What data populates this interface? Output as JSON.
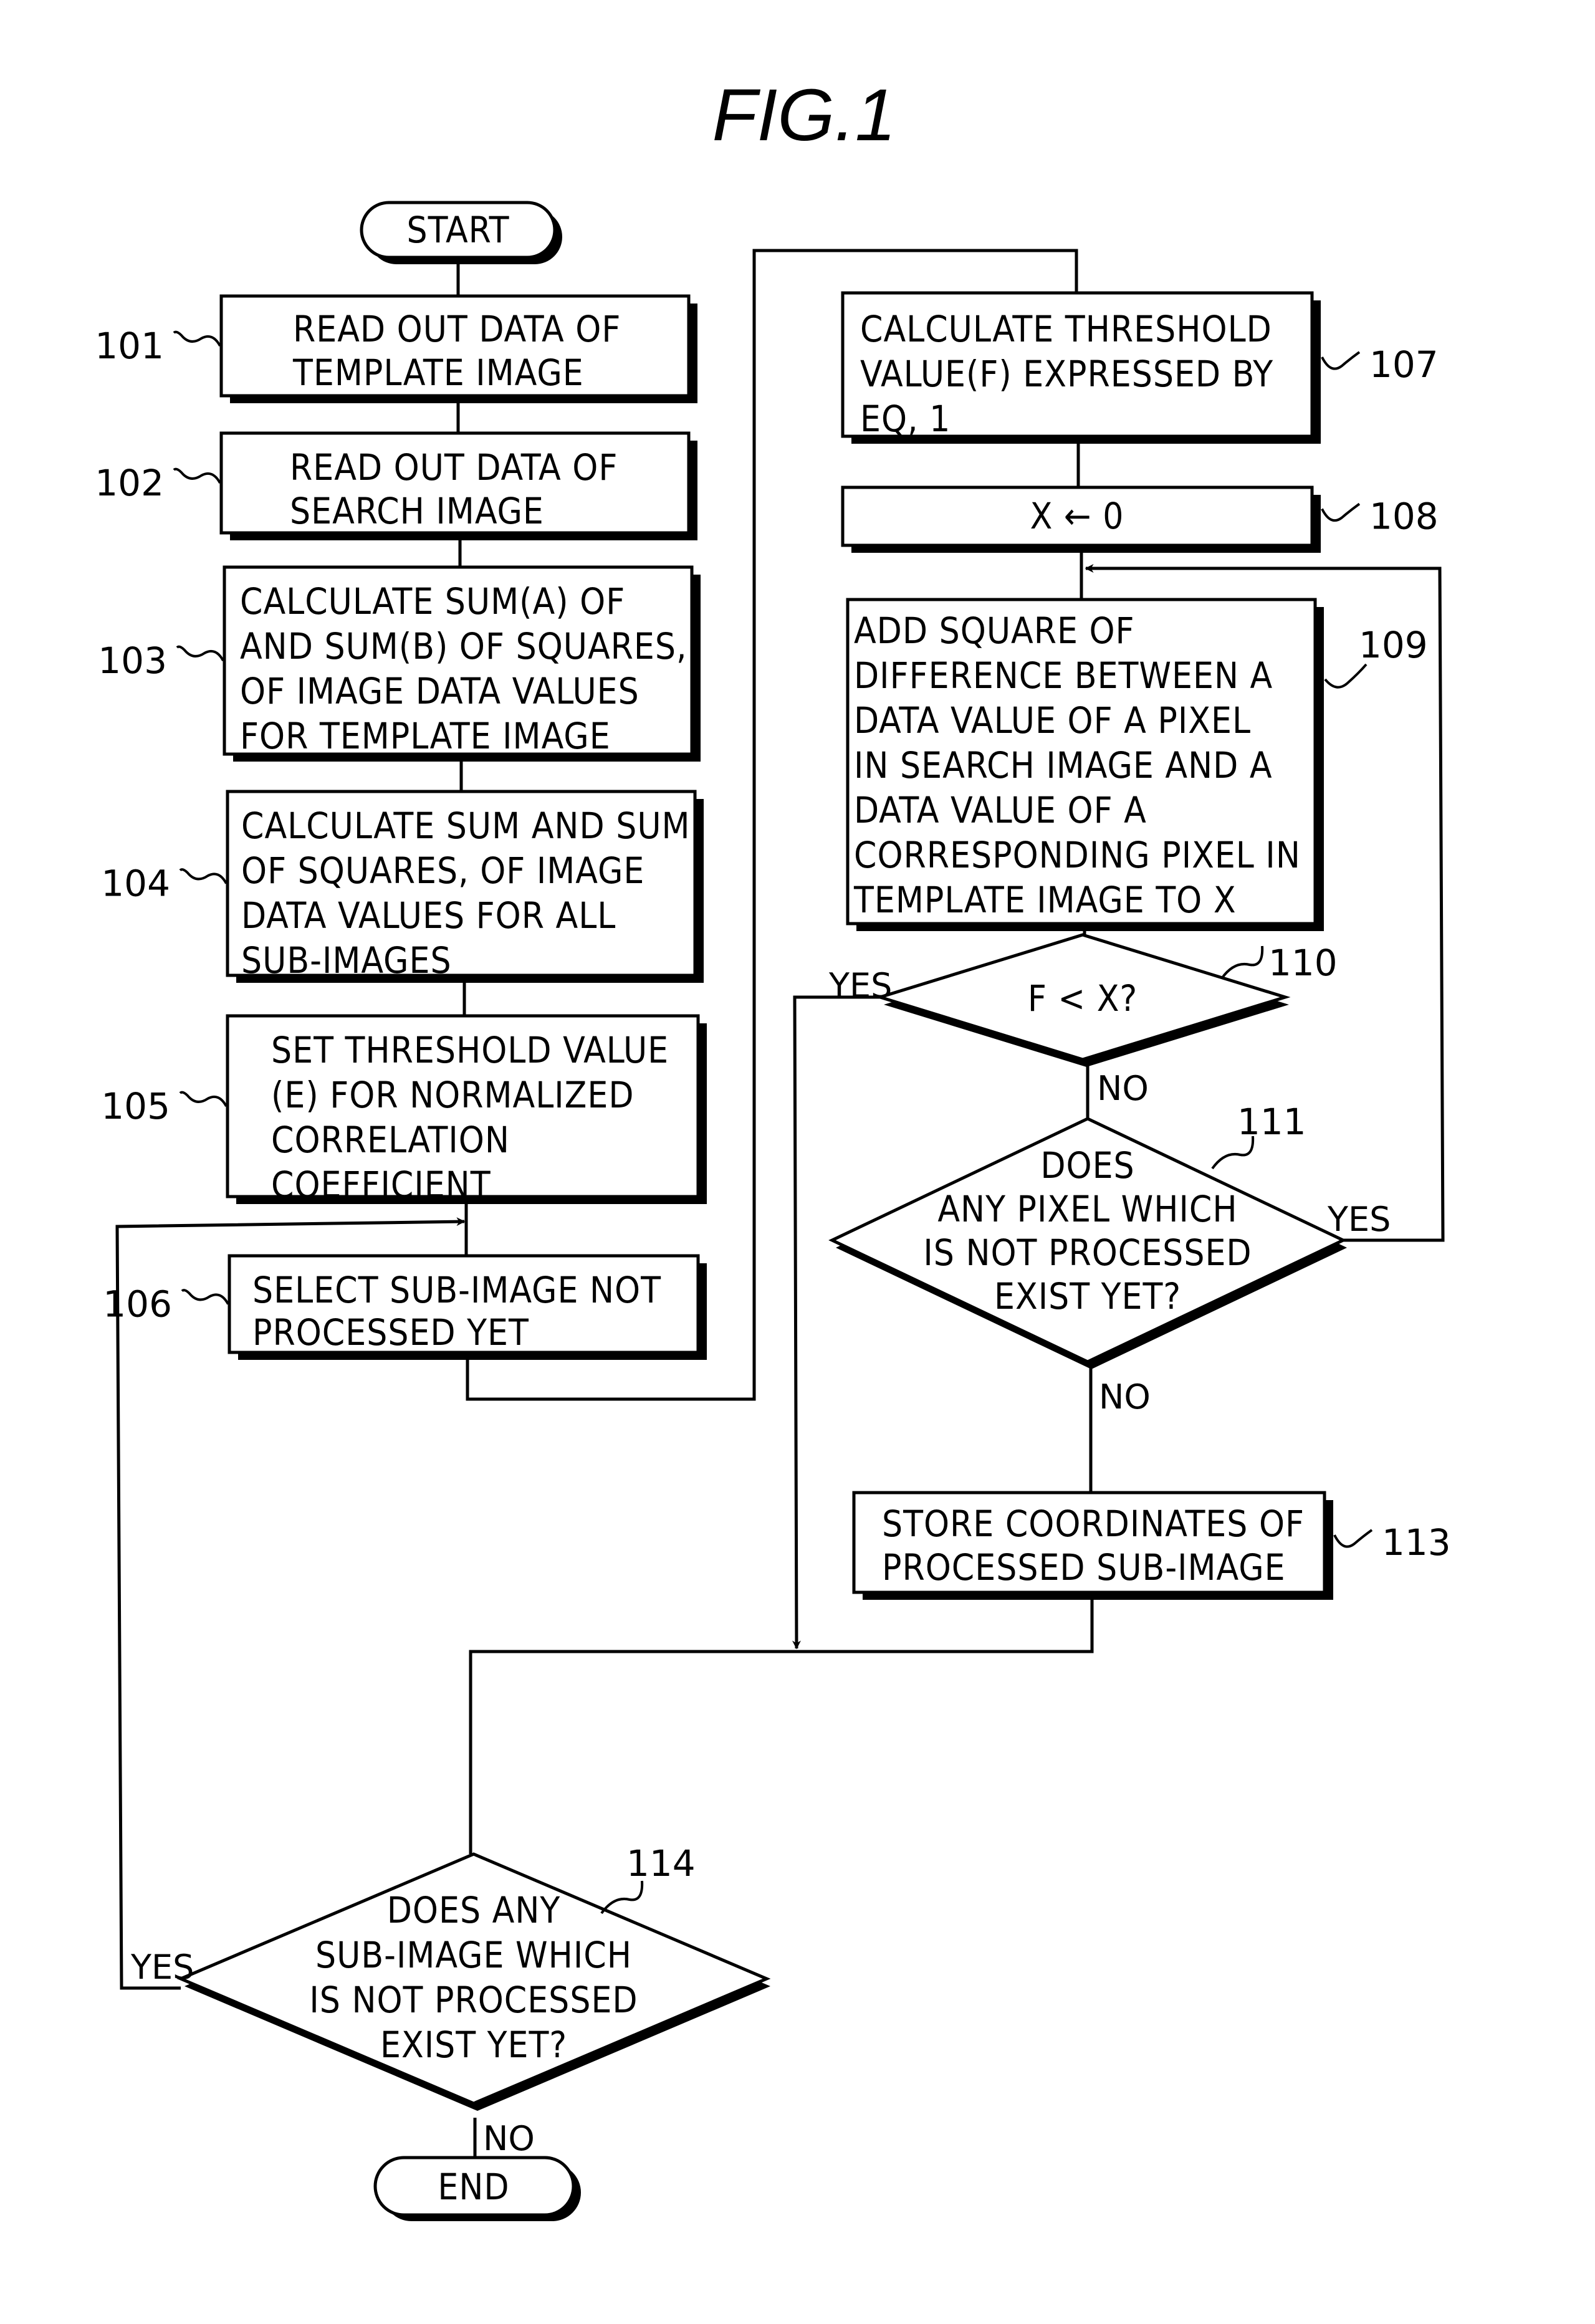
{
  "figure": {
    "title": "FIG.1"
  },
  "terminals": {
    "start": "START",
    "end": "END"
  },
  "steps": [
    {
      "ref": "101",
      "lines": [
        "READ OUT DATA OF",
        "TEMPLATE IMAGE"
      ]
    },
    {
      "ref": "102",
      "lines": [
        "READ OUT DATA OF",
        "SEARCH IMAGE"
      ]
    },
    {
      "ref": "103",
      "lines": [
        "CALCULATE SUM(A) OF",
        "AND SUM(B) OF SQUARES,",
        "OF IMAGE DATA VALUES",
        "FOR TEMPLATE IMAGE"
      ]
    },
    {
      "ref": "104",
      "lines": [
        "CALCULATE SUM AND SUM",
        "OF SQUARES, OF IMAGE",
        "DATA VALUES FOR ALL",
        "SUB-IMAGES"
      ]
    },
    {
      "ref": "105",
      "lines": [
        "SET THRESHOLD VALUE",
        "(E) FOR NORMALIZED",
        "CORRELATION",
        "COEFFICIENT"
      ]
    },
    {
      "ref": "106",
      "lines": [
        "SELECT SUB-IMAGE NOT",
        "PROCESSED YET"
      ]
    },
    {
      "ref": "107",
      "lines": [
        "CALCULATE THRESHOLD",
        "VALUE(F) EXPRESSED BY",
        "EQ, 1"
      ]
    },
    {
      "ref": "108",
      "lines": [
        "X ← 0"
      ]
    },
    {
      "ref": "109",
      "lines": [
        "ADD SQUARE OF",
        "DIFFERENCE BETWEEN A",
        "DATA VALUE OF A PIXEL",
        "IN SEARCH IMAGE AND A",
        "DATA VALUE OF A",
        "CORRESPONDING PIXEL IN",
        "TEMPLATE IMAGE TO X"
      ]
    },
    {
      "ref": "113",
      "lines": [
        "STORE COORDINATES OF",
        "PROCESSED SUB-IMAGE"
      ]
    }
  ],
  "decisions": [
    {
      "ref": "110",
      "lines": [
        "F < X?"
      ],
      "yes": "YES",
      "no": "NO"
    },
    {
      "ref": "111",
      "lines": [
        "DOES",
        "ANY PIXEL WHICH",
        "IS NOT PROCESSED",
        "EXIST YET?"
      ],
      "yes": "YES",
      "no": "NO"
    },
    {
      "ref": "114",
      "lines": [
        "DOES ANY",
        "SUB-IMAGE WHICH",
        "IS NOT PROCESSED",
        "EXIST YET?"
      ],
      "yes": "YES",
      "no": "NO"
    }
  ]
}
